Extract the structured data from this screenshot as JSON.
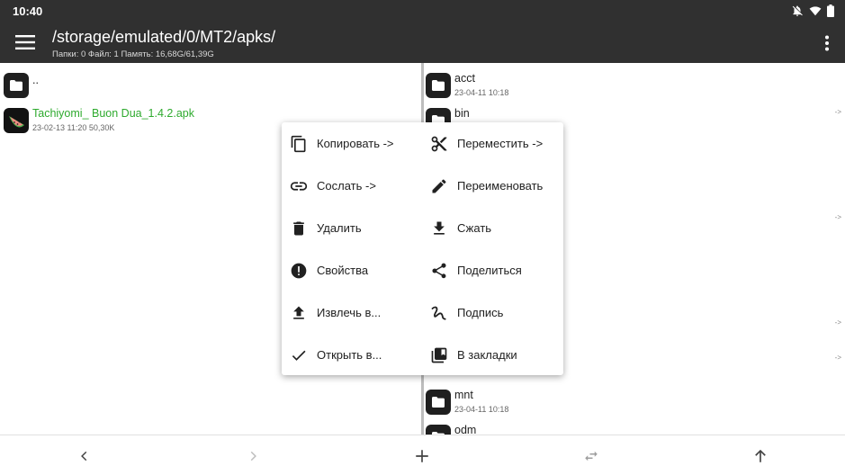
{
  "status_bar": {
    "time": "10:40"
  },
  "toolbar": {
    "path": "/storage/emulated/0/MT2/apks/",
    "info": "Папки: 0  Файл: 1  Память: 16,68G/61,39G"
  },
  "left_panel": {
    "parent": "..",
    "files": [
      {
        "name": "Tachiyomi_ Buon Dua_1.4.2.apk",
        "meta": "23-02-13 11:20  50,30K"
      }
    ]
  },
  "right_panel": {
    "items": [
      {
        "name": "acct",
        "meta": "23-04-11 10:18"
      },
      {
        "name": "bin",
        "meta": ""
      },
      {
        "name": "mnt",
        "meta": "23-04-11 10:18"
      },
      {
        "name": "odm",
        "meta": ""
      }
    ],
    "arrow": "->"
  },
  "context_menu": {
    "left": [
      {
        "label": "Копировать ->",
        "icon": "copy-icon"
      },
      {
        "label": "Сослать ->",
        "icon": "link-icon"
      },
      {
        "label": "Удалить",
        "icon": "delete-icon"
      },
      {
        "label": "Свойства",
        "icon": "info-icon"
      },
      {
        "label": "Извлечь в...",
        "icon": "upload-icon"
      },
      {
        "label": "Открыть в...",
        "icon": "check-icon"
      }
    ],
    "right": [
      {
        "label": "Переместить ->",
        "icon": "scissors-icon"
      },
      {
        "label": "Переименовать",
        "icon": "pencil-icon"
      },
      {
        "label": "Сжать",
        "icon": "download-icon"
      },
      {
        "label": "Поделиться",
        "icon": "share-icon"
      },
      {
        "label": "Подпись",
        "icon": "signature-icon"
      },
      {
        "label": "В закладки",
        "icon": "bookmarks-icon"
      }
    ]
  },
  "colors": {
    "bar": "#303030",
    "apk_text": "#2eaa2e",
    "folder": "#1f1f1f"
  }
}
